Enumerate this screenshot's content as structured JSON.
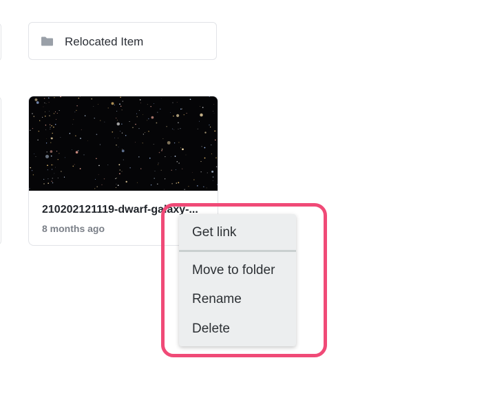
{
  "folder": {
    "name": "Relocated Item",
    "icon": "folder-icon"
  },
  "file": {
    "name": "210202121119-dwarf-galaxy-...",
    "modified": "8 months ago"
  },
  "context_menu": {
    "items": [
      {
        "label": "Get link"
      },
      {
        "label": "Move to folder"
      },
      {
        "label": "Rename"
      },
      {
        "label": "Delete"
      }
    ]
  },
  "colors": {
    "highlight": "#f04a77",
    "menu_background": "#eceeef",
    "thumbnail_background": "#050507"
  }
}
